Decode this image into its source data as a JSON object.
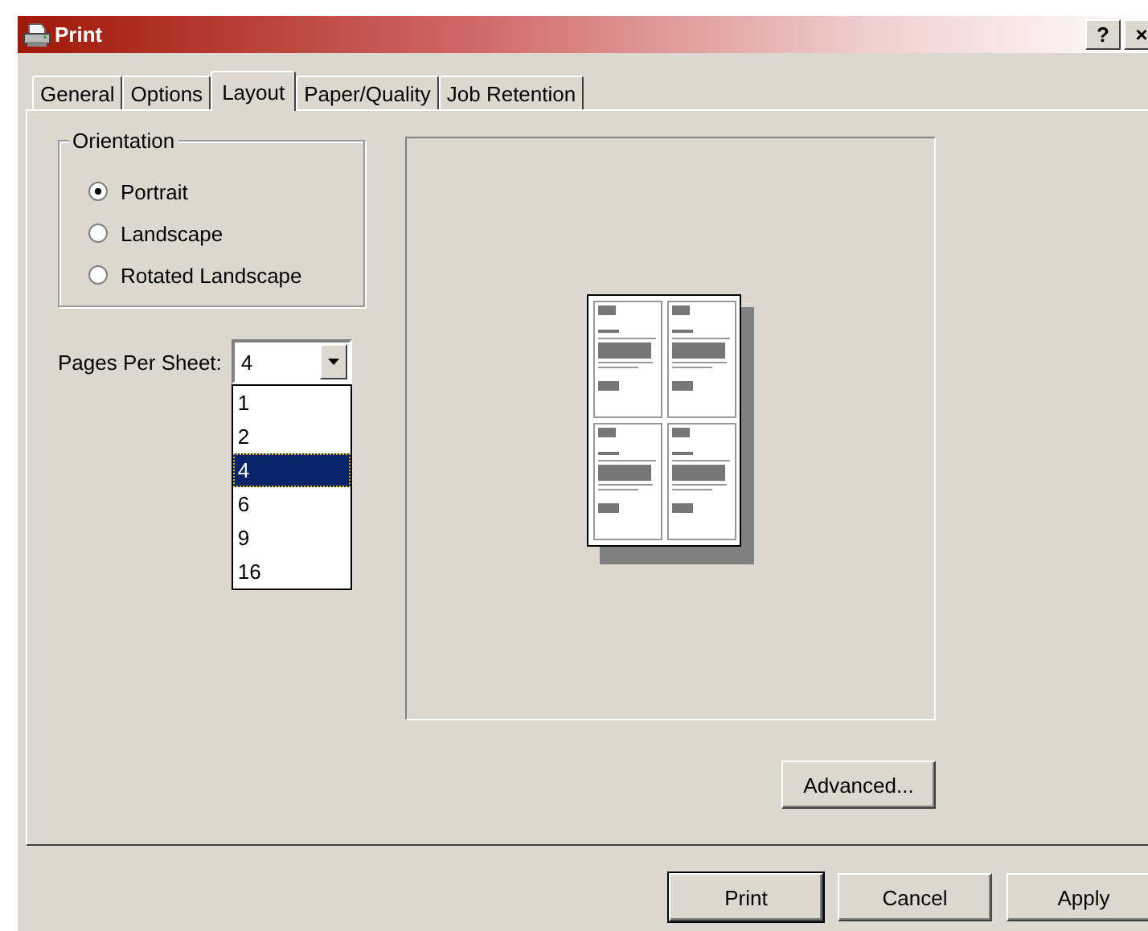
{
  "window": {
    "title": "Print",
    "help": "?",
    "close": "×"
  },
  "tabs": [
    {
      "label": "General",
      "selected": false
    },
    {
      "label": "Options",
      "selected": false
    },
    {
      "label": "Layout",
      "selected": true
    },
    {
      "label": "Paper/Quality",
      "selected": false
    },
    {
      "label": "Job Retention",
      "selected": false
    }
  ],
  "orientation": {
    "title": "Orientation",
    "options": [
      {
        "label": "Portrait",
        "selected": true
      },
      {
        "label": "Landscape",
        "selected": false
      },
      {
        "label": "Rotated Landscape",
        "selected": false
      }
    ]
  },
  "pages_per_sheet": {
    "label": "Pages Per Sheet:",
    "value": "4",
    "expanded": true,
    "options": [
      {
        "label": "1",
        "selected": false
      },
      {
        "label": "2",
        "selected": false
      },
      {
        "label": "4",
        "selected": true
      },
      {
        "label": "6",
        "selected": false
      },
      {
        "label": "9",
        "selected": false
      },
      {
        "label": "16",
        "selected": false
      }
    ]
  },
  "advanced_button": "Advanced...",
  "buttons": [
    "Print",
    "Cancel",
    "Apply"
  ]
}
